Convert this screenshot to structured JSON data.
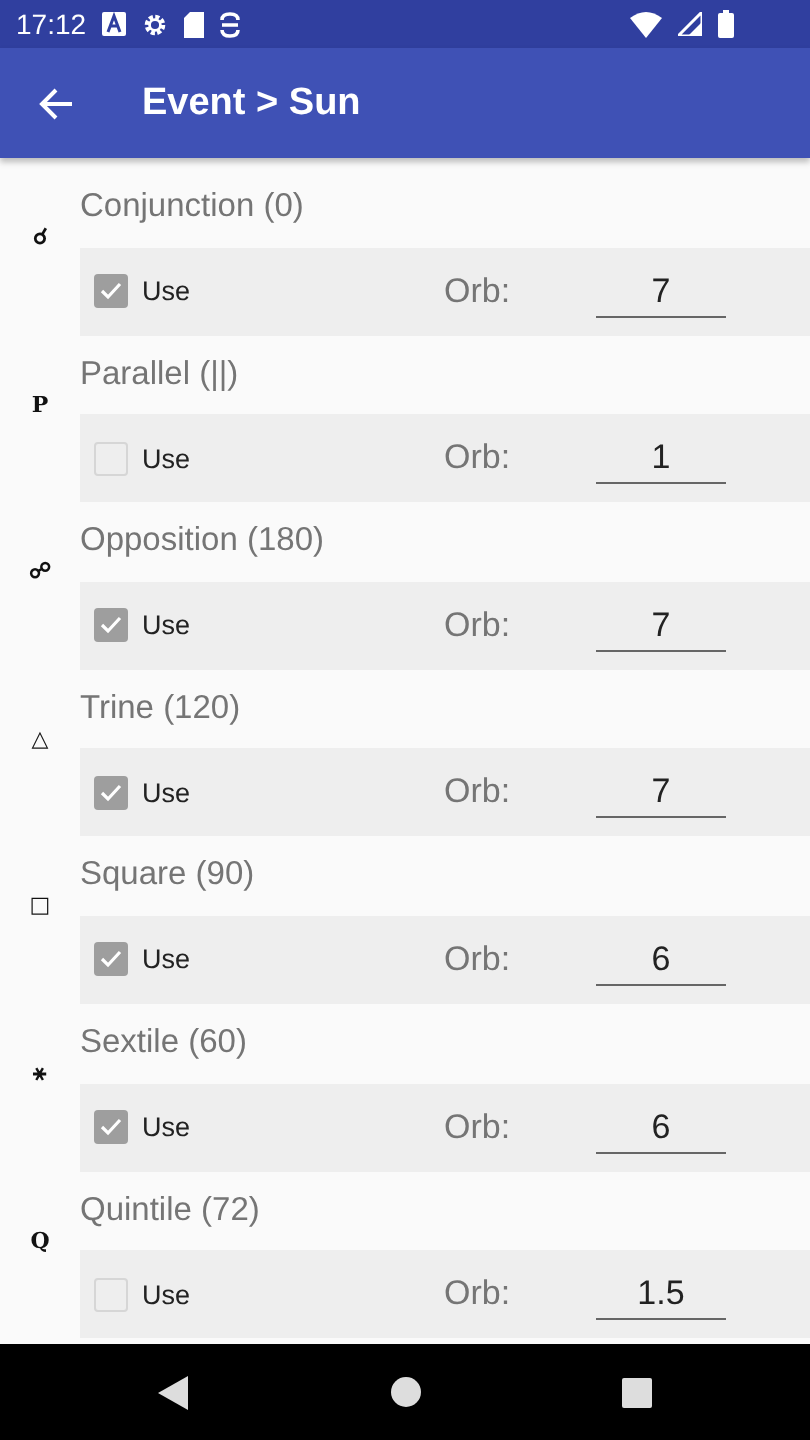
{
  "status_bar": {
    "time": "17:12"
  },
  "app_bar": {
    "title": "Event > Sun"
  },
  "aspects": [
    {
      "symbol": "☌",
      "name": "Conjunction (0)",
      "use_label": "Use",
      "checked": true,
      "orb_label": "Orb:",
      "orb": "7"
    },
    {
      "symbol": "P",
      "name": "Parallel (||)",
      "use_label": "Use",
      "checked": false,
      "orb_label": "Orb:",
      "orb": "1"
    },
    {
      "symbol": "☍",
      "name": "Opposition (180)",
      "use_label": "Use",
      "checked": true,
      "orb_label": "Orb:",
      "orb": "7"
    },
    {
      "symbol": "△",
      "name": "Trine (120)",
      "use_label": "Use",
      "checked": true,
      "orb_label": "Orb:",
      "orb": "7"
    },
    {
      "symbol": "□",
      "name": "Square (90)",
      "use_label": "Use",
      "checked": true,
      "orb_label": "Orb:",
      "orb": "6"
    },
    {
      "symbol": "⚹",
      "name": "Sextile (60)",
      "use_label": "Use",
      "checked": true,
      "orb_label": "Orb:",
      "orb": "6"
    },
    {
      "symbol": "Q",
      "name": "Quintile (72)",
      "use_label": "Use",
      "checked": false,
      "orb_label": "Orb:",
      "orb": "1.5"
    }
  ]
}
